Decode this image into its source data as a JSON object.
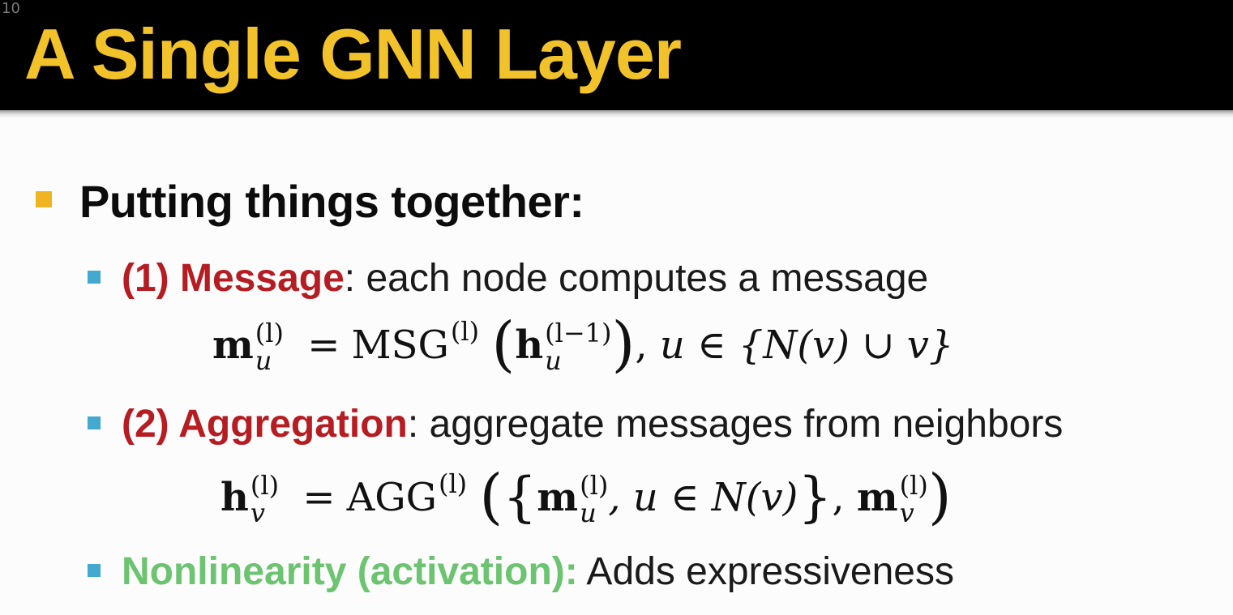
{
  "slide_number": "10",
  "title": "A Single GNN Layer",
  "colors": {
    "title": "#f2c22a",
    "header_bg": "#000000",
    "bullet_level1": "#f0b322",
    "bullet_level2": "#43a9cf",
    "highlight_red": "#b61d22",
    "highlight_green": "#6cc370"
  },
  "heading": "Putting things together:",
  "items": [
    {
      "label": "(1) Message",
      "text": ": each node computes a message"
    },
    {
      "label": "(2) Aggregation",
      "text": ": aggregate messages from neighbors"
    },
    {
      "label": "Nonlinearity (activation):",
      "text": " Adds expressiveness"
    }
  ],
  "formula1": {
    "lhs": "m",
    "lhs_sup": "(l)",
    "lhs_sub": "u",
    "eq": "=",
    "fn": "MSG",
    "fn_sup": "(l)",
    "lparen": "(",
    "arg": "h",
    "arg_sup": "(l−1)",
    "arg_sub": "u",
    "rparen": ")",
    "rest_comma": ",",
    "rest_var": "u",
    "rest_in": "∈",
    "rest_set": "{N(v) ∪ v}"
  },
  "formula2": {
    "lhs": "h",
    "lhs_sup": "(l)",
    "lhs_sub": "v",
    "eq": "=",
    "fn": "AGG",
    "fn_sup": "(l)",
    "lparen": "(",
    "lbrace": "{",
    "inner": "m",
    "inner_sup": "(l)",
    "inner_sub": "u",
    "inner_rest": ", u ∈ N(v)",
    "rbrace": "}",
    "comma": ",",
    "self": "m",
    "self_sup": "(l)",
    "self_sub": "v",
    "rparen": ")"
  }
}
